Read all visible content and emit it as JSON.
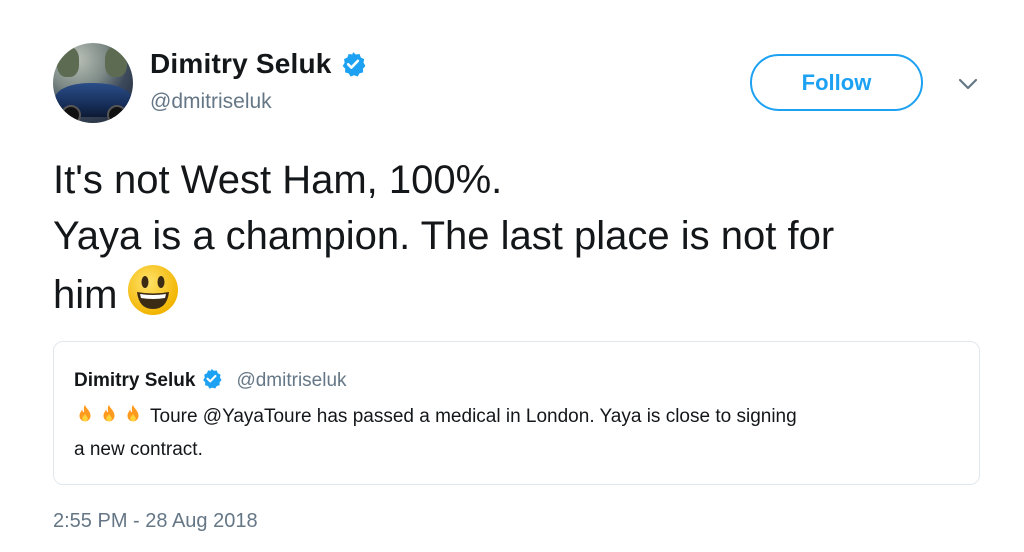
{
  "author": {
    "name": "Dimitry Seluk",
    "handle": "@dmitriseluk"
  },
  "follow_button": {
    "label": "Follow"
  },
  "tweet": {
    "lines": [
      "It's not West Ham, 100%.",
      "Yaya is a champion. The last place is not for",
      "him"
    ],
    "emoji": "smiling-face-icon"
  },
  "quoted_tweet": {
    "name": "Dimitry Seluk",
    "handle": "@dmitriseluk",
    "emoji": [
      "fire-icon",
      "fire-icon",
      "fire-icon"
    ],
    "text_line1": "Toure @YayaToure has passed a medical in London. Yaya is close to signing",
    "text_line2": "a new contract."
  },
  "timestamp": "2:55 PM - 28 Aug 2018",
  "colors": {
    "accent": "#1da1f2",
    "secondary_text": "#657786",
    "border": "#e1e8ed"
  }
}
